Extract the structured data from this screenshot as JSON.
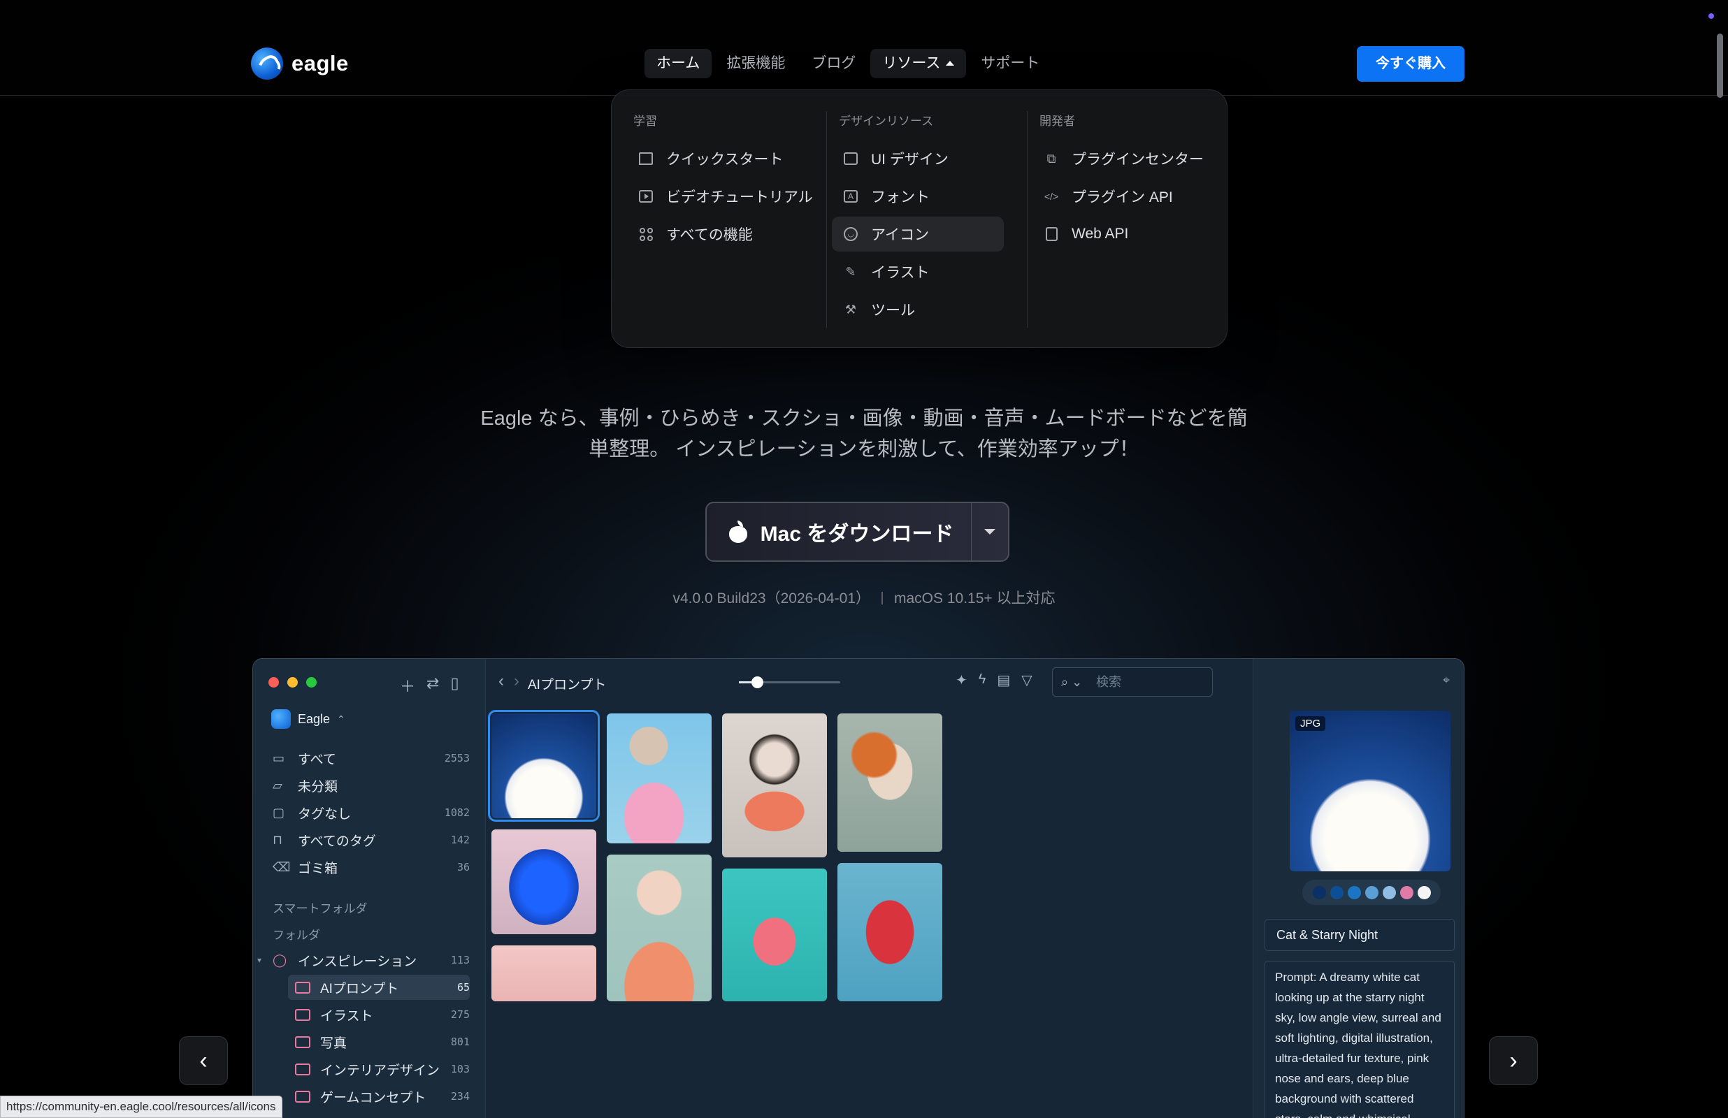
{
  "header": {
    "brand": "eagle",
    "nav": [
      {
        "label": "ホーム"
      },
      {
        "label": "拡張機能"
      },
      {
        "label": "ブログ"
      },
      {
        "label": "リソース"
      },
      {
        "label": "サポート"
      }
    ],
    "buy_label": "今すぐ購入"
  },
  "dropdown": {
    "columns": [
      {
        "title": "学習",
        "items": [
          {
            "label": "クイックスタート",
            "icon": "flag-icon"
          },
          {
            "label": "ビデオチュートリアル",
            "icon": "play-icon"
          },
          {
            "label": "すべての機能",
            "icon": "grid-icon"
          }
        ]
      },
      {
        "title": "デザインリソース",
        "items": [
          {
            "label": "UI デザイン",
            "icon": "layout-icon"
          },
          {
            "label": "フォント",
            "icon": "font-icon"
          },
          {
            "label": "アイコン",
            "icon": "smile-icon"
          },
          {
            "label": "イラスト",
            "icon": "brush-icon"
          },
          {
            "label": "ツール",
            "icon": "tool-icon"
          }
        ]
      },
      {
        "title": "開発者",
        "items": [
          {
            "label": "プラグインセンター",
            "icon": "puzzle-icon"
          },
          {
            "label": "プラグイン API",
            "icon": "code-icon"
          },
          {
            "label": "Web API",
            "icon": "doc-icon"
          }
        ]
      }
    ]
  },
  "hero": {
    "subtitle_line1": "Eagle なら、事例・ひらめき・スクショ・画像・動画・音声・ムードボードなどを簡",
    "subtitle_line2": "単整理。 インスピレーションを刺激して、作業効率アップ！",
    "download_label": "Mac をダウンロード",
    "version": "v4.0.0 Build23（2026-04-01）",
    "os": "macOS 10.15+ 以上対応"
  },
  "app": {
    "library": "Eagle",
    "sidebar": [
      {
        "label": "すべて",
        "count": "2553"
      },
      {
        "label": "未分類",
        "count": ""
      },
      {
        "label": "タグなし",
        "count": "1082"
      },
      {
        "label": "すべてのタグ",
        "count": "142"
      },
      {
        "label": "ゴミ箱",
        "count": "36"
      }
    ],
    "smart_folders": "スマートフォルダ",
    "folders_head": "フォルダ",
    "folder_root": {
      "label": "インスピレーション",
      "count": "113"
    },
    "folders": [
      {
        "label": "AIプロンプト",
        "count": "65"
      },
      {
        "label": "イラスト",
        "count": "275"
      },
      {
        "label": "写真",
        "count": "801"
      },
      {
        "label": "インテリアデザイン",
        "count": "103"
      },
      {
        "label": "ゲームコンセプト",
        "count": "234"
      }
    ],
    "breadcrumb": "AIプロンプト",
    "zoom": 0.18,
    "search_placeholder": "検索",
    "inspector": {
      "badge": "JPG",
      "palette": [
        "#0c2f66",
        "#0d4f96",
        "#1b75c2",
        "#5a9fd6",
        "#8fbde4",
        "#e07ba8",
        "#f4f4f4"
      ],
      "name": "Cat & Starry Night",
      "prompt": "Prompt: A dreamy white cat looking up at the starry night sky, low angle view, surreal and soft lighting, digital illustration, ultra-detailed fur texture, pink nose and ears, deep blue background with scattered stars, calm and whimsical atmosphere, cinematic"
    }
  },
  "status_url": "https://community-en.eagle.cool/resources/all/icons"
}
